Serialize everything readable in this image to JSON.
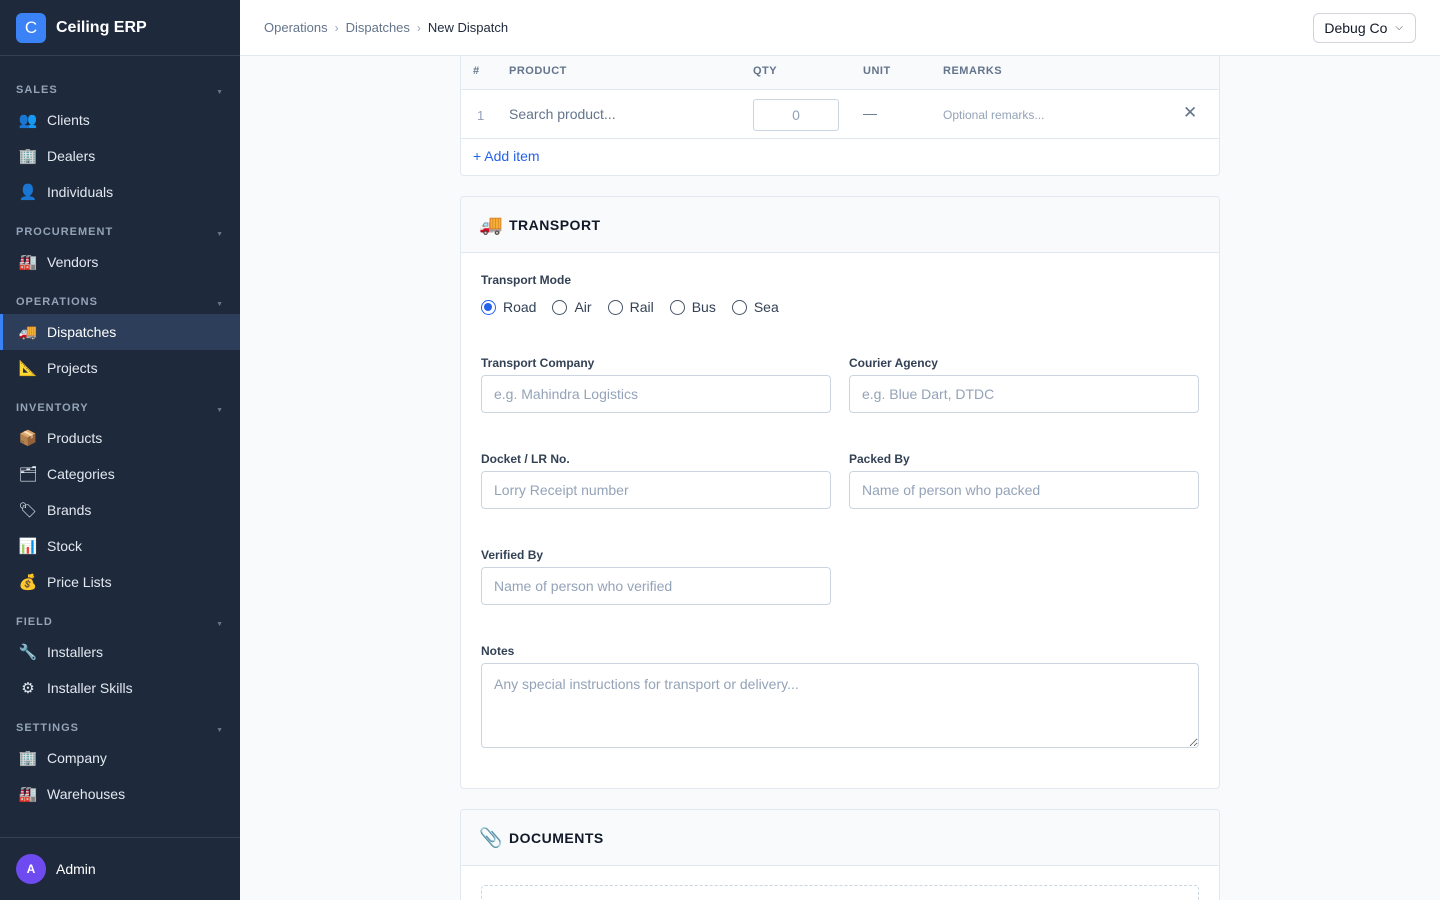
{
  "app": {
    "name": "Ceiling ERP",
    "logo_letter": "C"
  },
  "sidebar": {
    "sections": [
      {
        "title": "SALES",
        "items": [
          {
            "label": "Clients",
            "icon": "people-icon"
          },
          {
            "label": "Dealers",
            "icon": "office-building-icon"
          },
          {
            "label": "Individuals",
            "icon": "person-icon"
          }
        ]
      },
      {
        "title": "PROCUREMENT",
        "items": [
          {
            "label": "Vendors",
            "icon": "factory-icon"
          }
        ]
      },
      {
        "title": "OPERATIONS",
        "items": [
          {
            "label": "Dispatches",
            "icon": "truck-icon",
            "active": true
          },
          {
            "label": "Projects",
            "icon": "triangle-ruler-icon"
          }
        ]
      },
      {
        "title": "INVENTORY",
        "items": [
          {
            "label": "Products",
            "icon": "package-icon"
          },
          {
            "label": "Categories",
            "icon": "folder-icon"
          },
          {
            "label": "Brands",
            "icon": "tag-icon"
          },
          {
            "label": "Stock",
            "icon": "bar-chart-icon"
          },
          {
            "label": "Price Lists",
            "icon": "money-bag-icon"
          }
        ]
      },
      {
        "title": "FIELD",
        "items": [
          {
            "label": "Installers",
            "icon": "wrench-icon"
          },
          {
            "label": "Installer Skills",
            "icon": "gear-icon"
          }
        ]
      },
      {
        "title": "SETTINGS",
        "items": [
          {
            "label": "Company",
            "icon": "office-building-icon"
          },
          {
            "label": "Warehouses",
            "icon": "factory-icon"
          }
        ]
      }
    ],
    "user": {
      "name": "Admin",
      "initial": "A"
    }
  },
  "breadcrumb": {
    "items": [
      "Operations",
      "Dispatches"
    ],
    "current": "New Dispatch"
  },
  "company_selector": {
    "value": "Debug Co"
  },
  "items_table": {
    "columns": {
      "num": "#",
      "product": "PRODUCT",
      "qty": "QTY",
      "unit": "UNIT",
      "remarks": "REMARKS"
    },
    "rows": [
      {
        "num": "1",
        "product_placeholder": "Search product...",
        "qty": "0",
        "unit": "—",
        "remarks_placeholder": "Optional remarks..."
      }
    ],
    "add_item_label": "+ Add item"
  },
  "transport": {
    "title": "TRANSPORT",
    "icon": "truck-icon",
    "mode_label": "Transport Mode",
    "modes": [
      "Road",
      "Air",
      "Rail",
      "Bus",
      "Sea"
    ],
    "selected_mode": "Road",
    "transport_company": {
      "label": "Transport Company",
      "placeholder": "e.g. Mahindra Logistics",
      "value": ""
    },
    "courier_agency": {
      "label": "Courier Agency",
      "placeholder": "e.g. Blue Dart, DTDC",
      "value": ""
    },
    "docket": {
      "label": "Docket / LR No.",
      "placeholder": "Lorry Receipt number",
      "value": ""
    },
    "packed_by": {
      "label": "Packed By",
      "placeholder": "Name of person who packed",
      "value": ""
    },
    "verified_by": {
      "label": "Verified By",
      "placeholder": "Name of person who verified",
      "value": ""
    },
    "notes": {
      "label": "Notes",
      "placeholder": "Any special instructions for transport or delivery...",
      "value": ""
    }
  },
  "documents": {
    "title": "DOCUMENTS",
    "icon": "paperclip-icon"
  }
}
